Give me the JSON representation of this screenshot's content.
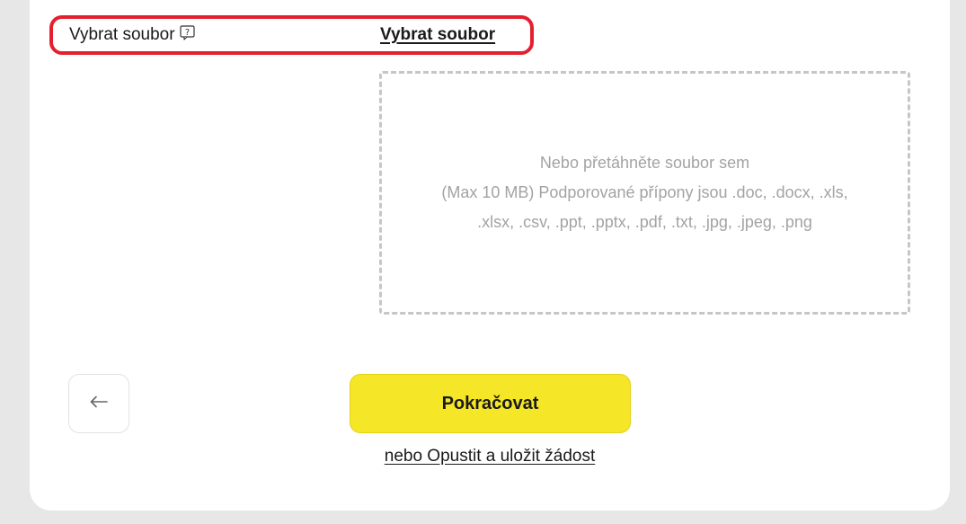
{
  "file_field": {
    "label": "Vybrat soubor",
    "help_icon": "help-icon",
    "select_link": "Vybrat soubor"
  },
  "dropzone": {
    "line1": "Nebo přetáhněte soubor sem",
    "line2": "(Max 10 MB) Podporované přípony jsou .doc, .docx, .xls,",
    "line3": ".xlsx, .csv, .ppt, .pptx, .pdf, .txt, .jpg, .jpeg, .png"
  },
  "actions": {
    "back_icon": "arrow-left-icon",
    "continue_label": "Pokračovat",
    "save_link": "nebo Opustit a uložit žádost"
  },
  "colors": {
    "highlight_border": "#e5202e",
    "primary_button": "#f5e627",
    "background": "#e7e7e7"
  }
}
